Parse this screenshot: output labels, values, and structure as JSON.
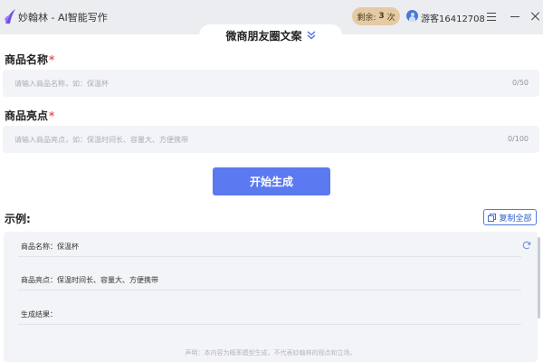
{
  "header": {
    "app_title": "妙翰林 - AI智能写作",
    "quota_label": "剩余:",
    "quota_count": "3",
    "quota_unit": "次",
    "username": "游客16412708",
    "accent_color": "#5b79f0"
  },
  "tab": {
    "label": "微商朋友圈文案",
    "icon": "double-chevron-down-icon"
  },
  "form": {
    "name_label": "商品名称",
    "name_placeholder": "请输入商品名称，如：保温杯",
    "name_count": "0/50",
    "highlight_label": "商品亮点",
    "highlight_placeholder": "请输入商品亮点，如：保温时间长、容量大、方便携带",
    "highlight_count": "0/100",
    "required_mark": "*",
    "generate_label": "开始生成"
  },
  "example": {
    "title": "示例:",
    "copy_all_label": "复制全部",
    "rows": [
      "商品名称：保温杯",
      "商品亮点：保温时间长、容量大、方便携带",
      "生成结果："
    ],
    "disclaimer": "声明：本内容为概率模型生成，不代表妙翰林的观点和立场。"
  }
}
